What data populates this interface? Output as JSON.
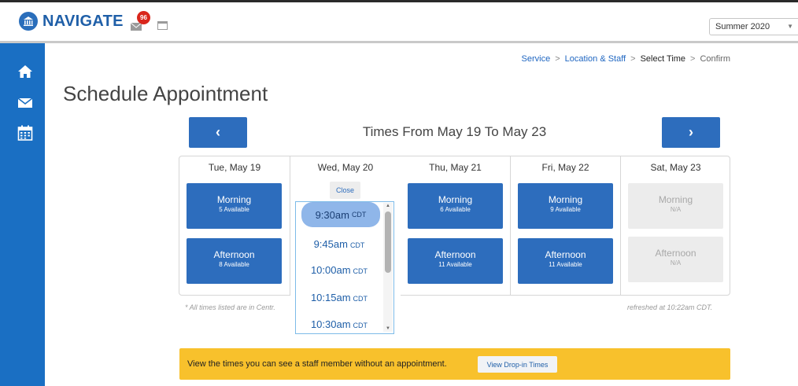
{
  "header": {
    "brand": "NAVIGATE",
    "mail_badge": "96",
    "term_selected": "Summer 2020"
  },
  "sidebar": {
    "items": [
      {
        "icon": "home-icon"
      },
      {
        "icon": "mail-icon"
      },
      {
        "icon": "calendar-icon"
      }
    ]
  },
  "breadcrumb": {
    "items": [
      "Service",
      "Location & Staff",
      "Select Time",
      "Confirm"
    ],
    "separator": ">"
  },
  "page": {
    "title": "Schedule Appointment"
  },
  "week": {
    "prev_label": "‹",
    "next_label": "›",
    "title": "Times From May 19 To May 23"
  },
  "days": [
    {
      "label": "Tue, May 19",
      "morning": {
        "name": "Morning",
        "avail": "5 Available"
      },
      "afternoon": {
        "name": "Afternoon",
        "avail": "8 Available"
      }
    },
    {
      "label": "Wed, May 20"
    },
    {
      "label": "Thu, May 21",
      "morning": {
        "name": "Morning",
        "avail": "6 Available"
      },
      "afternoon": {
        "name": "Afternoon",
        "avail": "11 Available"
      }
    },
    {
      "label": "Fri, May 22",
      "morning": {
        "name": "Morning",
        "avail": "9 Available"
      },
      "afternoon": {
        "name": "Afternoon",
        "avail": "11 Available"
      }
    },
    {
      "label": "Sat, May 23",
      "morning": {
        "name": "Morning",
        "avail": "N/A"
      },
      "afternoon": {
        "name": "Afternoon",
        "avail": "N/A"
      }
    }
  ],
  "dropdown": {
    "close_label": "Close",
    "times": [
      {
        "time": "9:30am",
        "tz": "CDT"
      },
      {
        "time": "9:45am",
        "tz": "CDT"
      },
      {
        "time": "10:00am",
        "tz": "CDT"
      },
      {
        "time": "10:15am",
        "tz": "CDT"
      },
      {
        "time": "10:30am",
        "tz": "CDT"
      }
    ]
  },
  "footnotes": {
    "left": "* All times listed are in Centr.",
    "right": "refreshed at 10:22am CDT."
  },
  "banner": {
    "text": "View the times you can see a staff member without an appointment.",
    "button_label": "View Drop-in Times"
  },
  "colors": {
    "brand_blue": "#2d6dbd",
    "sidebar_blue": "#1a6fc3",
    "banner_yellow": "#f8c12c",
    "badge_red": "#d9261c"
  }
}
